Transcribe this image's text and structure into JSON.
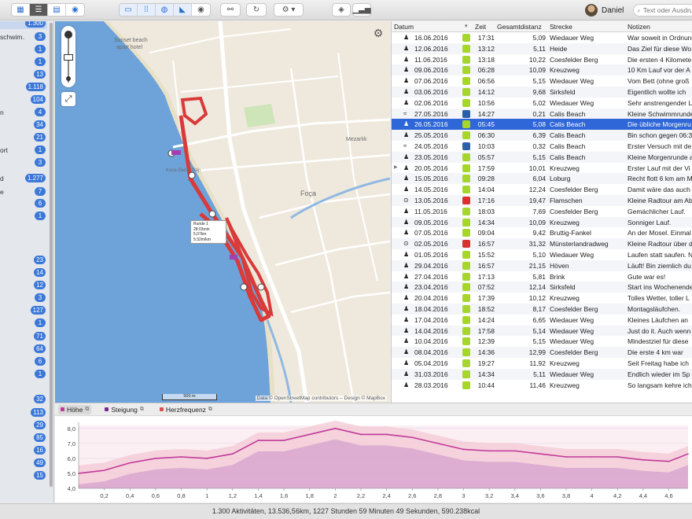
{
  "toolbar": {
    "user_name": "Daniel",
    "search_placeholder": "Text oder Ausdruck"
  },
  "sidebar": {
    "items": [
      {
        "label": "",
        "count": "1.300",
        "selected": true
      },
      {
        "label": "schwim…",
        "count": "3"
      },
      {
        "label": "",
        "count": "1"
      },
      {
        "label": "",
        "count": "1"
      },
      {
        "label": "",
        "count": "13"
      },
      {
        "label": "",
        "count": "1.118"
      },
      {
        "label": "",
        "count": "104"
      },
      {
        "label": "n",
        "count": "4"
      },
      {
        "label": "",
        "count": "34"
      },
      {
        "label": "",
        "count": "21"
      },
      {
        "label": "ort",
        "count": "1"
      },
      {
        "label": "",
        "count": "3"
      },
      {
        "label": "d",
        "count": "1.277"
      },
      {
        "label": "e",
        "count": "7"
      },
      {
        "label": "",
        "count": "6"
      },
      {
        "label": "",
        "count": "1"
      },
      {
        "label": "",
        "count": "23"
      },
      {
        "label": "",
        "count": "14"
      },
      {
        "label": "",
        "count": "12"
      },
      {
        "label": "",
        "count": "3"
      },
      {
        "label": "",
        "count": "127"
      },
      {
        "label": "",
        "count": "1"
      },
      {
        "label": "",
        "count": "71"
      },
      {
        "label": "",
        "count": "64"
      },
      {
        "label": "",
        "count": "6"
      },
      {
        "label": "",
        "count": "1"
      },
      {
        "label": "",
        "count": "32"
      },
      {
        "label": "",
        "count": "113"
      },
      {
        "label": "",
        "count": "29"
      },
      {
        "label": "",
        "count": "85"
      },
      {
        "label": "",
        "count": "16"
      },
      {
        "label": "",
        "count": "49"
      },
      {
        "label": "",
        "count": "15"
      }
    ]
  },
  "map": {
    "labels": [
      {
        "text": "Sunset beach"
      },
      {
        "text": "apart hotel"
      },
      {
        "text": "Foça"
      },
      {
        "text": "Mezarlık"
      },
      {
        "text": "CAHİT BEĞENÇ BLV"
      },
      {
        "text": "Koca Deniz Plajı"
      },
      {
        "text": "ŞEHİT BEĞENÇ BLV"
      }
    ],
    "popup": {
      "line1": "Runde 1",
      "line2": "28:03min",
      "line3": "5,07km",
      "line4": "5:32m/km"
    },
    "scale": "500 m",
    "attribution": "Data © OpenStreetMap contributors – Design © MapBox"
  },
  "list": {
    "headers": {
      "date": "Datum",
      "time": "Zeit",
      "distance": "Gesamtdistanz",
      "route": "Strecke",
      "notes": "Notizen"
    },
    "colors": {
      "green": "#a6d52c",
      "blue": "#2c5fa8",
      "red": "#d9312f"
    },
    "rows": [
      {
        "icon": "run",
        "date": "16.06.2016",
        "color": "green",
        "time": "17:31",
        "dist": "5,09",
        "route": "Wiedauer Weg",
        "note": "War soweit in Ordnung"
      },
      {
        "icon": "run",
        "date": "12.06.2016",
        "color": "green",
        "time": "13:12",
        "dist": "5,11",
        "route": "Heide",
        "note": "Das Ziel für diese Wo"
      },
      {
        "icon": "run",
        "date": "11.06.2016",
        "color": "green",
        "time": "13:18",
        "dist": "10,22",
        "route": "Coesfelder Berg",
        "note": "Die ersten 4 Kilomete"
      },
      {
        "icon": "run",
        "date": "09.06.2016",
        "color": "green",
        "time": "06:28",
        "dist": "10,09",
        "route": "Kreuzweg",
        "note": "10 Km Lauf vor der A"
      },
      {
        "icon": "run",
        "date": "07.06.2016",
        "color": "green",
        "time": "06:56",
        "dist": "5,15",
        "route": "Wiedauer Weg",
        "note": "Vom Bett (ohne groß"
      },
      {
        "icon": "run",
        "date": "03.06.2016",
        "color": "green",
        "time": "14:12",
        "dist": "9,68",
        "route": "Sirksfeld",
        "note": "Eigentlich wollte ich"
      },
      {
        "icon": "run",
        "date": "02.06.2016",
        "color": "green",
        "time": "10:56",
        "dist": "5,02",
        "route": "Wiedauer Weg",
        "note": "Sehr anstrengender L"
      },
      {
        "icon": "swim",
        "date": "27.05.2016",
        "color": "blue",
        "time": "14:27",
        "dist": "0,21",
        "route": "Calis Beach",
        "note": "Kleine Schwimmrunde"
      },
      {
        "icon": "run",
        "date": "26.05.2016",
        "color": "green",
        "time": "05:45",
        "dist": "5,08",
        "route": "Calis Beach",
        "note": "Die übliche Morgenru",
        "selected": true
      },
      {
        "icon": "run",
        "date": "25.05.2016",
        "color": "green",
        "time": "06:30",
        "dist": "6,39",
        "route": "Calis Beach",
        "note": "Bin schon gegen 06:3"
      },
      {
        "icon": "swim",
        "date": "24.05.2016",
        "color": "blue",
        "time": "10:03",
        "dist": "0,32",
        "route": "Calis Beach",
        "note": "Erster Versuch mit de"
      },
      {
        "icon": "run",
        "date": "23.05.2016",
        "color": "green",
        "time": "05:57",
        "dist": "5,15",
        "route": "Calis Beach",
        "note": "Kleine Morgenrunde a"
      },
      {
        "icon": "run",
        "date": "20.05.2016",
        "color": "green",
        "time": "17:59",
        "dist": "10,01",
        "route": "Kreuzweg",
        "note": "Erster Lauf mit der Vi",
        "arrow": true
      },
      {
        "icon": "run",
        "date": "15.05.2016",
        "color": "green",
        "time": "09:28",
        "dist": "6,04",
        "route": "Loburg",
        "note": "Recht flott 6 km am M"
      },
      {
        "icon": "run",
        "date": "14.05.2016",
        "color": "green",
        "time": "14:04",
        "dist": "12,24",
        "route": "Coesfelder Berg",
        "note": "Damit wäre das auch"
      },
      {
        "icon": "bike",
        "date": "13.05.2016",
        "color": "red",
        "time": "17:16",
        "dist": "19,47",
        "route": "Flamschen",
        "note": "Kleine Radtour am Ab"
      },
      {
        "icon": "run",
        "date": "11.05.2016",
        "color": "green",
        "time": "18:03",
        "dist": "7,69",
        "route": "Coesfelder Berg",
        "note": "Gemächlicher Lauf."
      },
      {
        "icon": "run",
        "date": "09.05.2016",
        "color": "green",
        "time": "14:34",
        "dist": "10,09",
        "route": "Kreuzweg",
        "note": "Sonniger Lauf."
      },
      {
        "icon": "run",
        "date": "07.05.2016",
        "color": "green",
        "time": "09:04",
        "dist": "9,42",
        "route": "Bruttig-Fankel",
        "note": "An der Mosel. Einmal"
      },
      {
        "icon": "bike",
        "date": "02.05.2016",
        "color": "red",
        "time": "16:57",
        "dist": "31,32",
        "route": "Münsterlandradweg",
        "note": "Kleine Radtour über d"
      },
      {
        "icon": "run",
        "date": "01.05.2016",
        "color": "green",
        "time": "15:52",
        "dist": "5,10",
        "route": "Wiedauer Weg",
        "note": "Laufen statt saufen. N"
      },
      {
        "icon": "run",
        "date": "29.04.2016",
        "color": "green",
        "time": "16:57",
        "dist": "21,15",
        "route": "Höven",
        "note": "Läuft! Bin ziemlich du"
      },
      {
        "icon": "run",
        "date": "27.04.2016",
        "color": "green",
        "time": "17:13",
        "dist": "5,81",
        "route": "Brink",
        "note": "Gute war es!"
      },
      {
        "icon": "run",
        "date": "23.04.2016",
        "color": "green",
        "time": "07:52",
        "dist": "12,14",
        "route": "Sirksfeld",
        "note": "Start ins Wochenende"
      },
      {
        "icon": "run",
        "date": "20.04.2016",
        "color": "green",
        "time": "17:39",
        "dist": "10,12",
        "route": "Kreuzweg",
        "note": "Tolles Wetter, toller L"
      },
      {
        "icon": "run",
        "date": "18.04.2016",
        "color": "green",
        "time": "18:52",
        "dist": "8,17",
        "route": "Coesfelder Berg",
        "note": "Montagsläufchen."
      },
      {
        "icon": "run",
        "date": "17.04.2016",
        "color": "green",
        "time": "14:24",
        "dist": "6,65",
        "route": "Wiedauer Weg",
        "note": "Kleines Läufchen an"
      },
      {
        "icon": "run",
        "date": "14.04.2016",
        "color": "green",
        "time": "17:58",
        "dist": "5,14",
        "route": "Wiedauer Weg",
        "note": "Just do it. Auch wenn"
      },
      {
        "icon": "run",
        "date": "10.04.2016",
        "color": "green",
        "time": "12:39",
        "dist": "5,15",
        "route": "Wiedauer Weg",
        "note": "Mindestziel für diese"
      },
      {
        "icon": "run",
        "date": "08.04.2016",
        "color": "green",
        "time": "14:36",
        "dist": "12,99",
        "route": "Coesfelder Berg",
        "note": "Die erste 4 km war"
      },
      {
        "icon": "run",
        "date": "05.04.2016",
        "color": "green",
        "time": "19:27",
        "dist": "11,92",
        "route": "Kreuzweg",
        "note": "Seit Freitag habe ich"
      },
      {
        "icon": "run",
        "date": "31.03.2016",
        "color": "green",
        "time": "14:34",
        "dist": "5,11",
        "route": "Wiedauer Weg",
        "note": "Endlich wieder im Sp"
      },
      {
        "icon": "run",
        "date": "28.03.2016",
        "color": "green",
        "time": "10:44",
        "dist": "11,46",
        "route": "Kreuzweg",
        "note": "So langsam kehre ich"
      }
    ]
  },
  "chart": {
    "legend": [
      {
        "label": "Höhe",
        "color": "#c0399a",
        "active": true
      },
      {
        "label": "Steigung",
        "color": "#7a2a8c"
      },
      {
        "label": "Herzfrequenz",
        "color": "#d9534f"
      }
    ],
    "y_ticks": [
      "8,0",
      "7,0",
      "6,0",
      "5,0",
      "4,0"
    ],
    "x_ticks": [
      "0,2",
      "0,4",
      "0,6",
      "0,8",
      "1",
      "1,2",
      "1,4",
      "1,6",
      "1,8",
      "2",
      "2,2",
      "2,4",
      "2,6",
      "2,8",
      "3",
      "3,2",
      "3,4",
      "3,6",
      "3,8",
      "4",
      "4,2",
      "4,4",
      "4,6"
    ]
  },
  "chart_data": {
    "type": "area",
    "x": [
      0,
      0.2,
      0.4,
      0.6,
      0.8,
      1.0,
      1.2,
      1.4,
      1.6,
      1.8,
      2.0,
      2.2,
      2.4,
      2.6,
      2.8,
      3.0,
      3.2,
      3.4,
      3.6,
      3.8,
      4.0,
      4.2,
      4.4,
      4.6,
      4.75
    ],
    "series": [
      {
        "name": "Höhe",
        "values": [
          5.0,
          5.2,
          5.7,
          6.0,
          6.1,
          6.0,
          6.3,
          7.2,
          7.2,
          7.6,
          8.0,
          7.6,
          7.6,
          7.4,
          7.0,
          6.6,
          6.5,
          6.5,
          6.3,
          6.1,
          6.1,
          6.1,
          5.9,
          5.8,
          6.3
        ]
      }
    ],
    "ylim": [
      4.0,
      8.2
    ],
    "xlim": [
      0,
      4.75
    ]
  },
  "status": {
    "summary": "1.300 Aktivitäten, 13.536,56km, 1227 Stunden 59 Minuten 49 Sekunden, 590.238kcal"
  }
}
